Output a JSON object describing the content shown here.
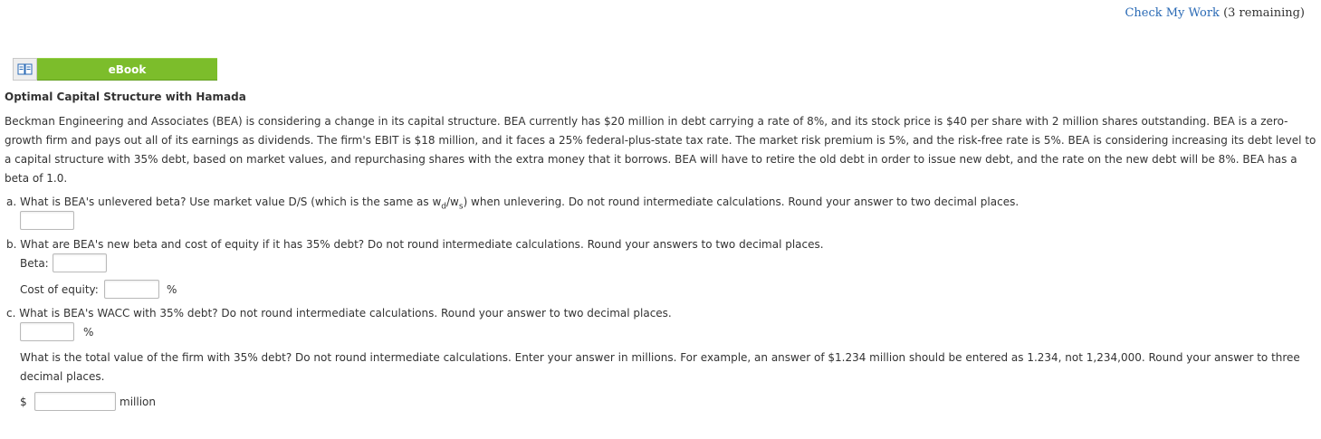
{
  "header": {
    "check_link": "Check My Work",
    "check_remaining": "(3 remaining)"
  },
  "ebook": {
    "icon": "book-icon",
    "label": "eBook"
  },
  "problem": {
    "title": "Optimal Capital Structure with Hamada",
    "intro": "Beckman Engineering and Associates (BEA) is considering a change in its capital structure. BEA currently has $20 million in debt carrying a rate of 8%, and its stock price is $40 per share with 2 million shares outstanding. BEA is a zero-growth firm and pays out all of its earnings as dividends. The firm's EBIT is $18 million, and it faces a 25% federal-plus-state tax rate. The market risk premium is 5%, and the risk-free rate is 5%. BEA is considering increasing its debt level to a capital structure with 35% debt, based on market values, and repurchasing shares with the extra money that it borrows. BEA will have to retire the old debt in order to issue new debt, and the rate on the new debt will be 8%. BEA has a beta of 1.0."
  },
  "questions": {
    "a": {
      "text_before": "a. What is BEA's unlevered beta? Use market value D/S (which is the same as w",
      "sub_d": "d",
      "slash": "/w",
      "sub_s": "s",
      "text_after": ") when unlevering. Do not round intermediate calculations. Round your answer to two decimal places.",
      "value": ""
    },
    "b": {
      "text": "b. What are BEA's new beta and cost of equity if it has 35% debt? Do not round intermediate calculations. Round your answers to two decimal places.",
      "beta_label": "Beta:",
      "beta_value": "",
      "coe_label": "Cost of equity:",
      "coe_value": "",
      "coe_unit": "%"
    },
    "c": {
      "text": "c. What is BEA's WACC with 35% debt? Do not round intermediate calculations. Round your answer to two decimal places.",
      "wacc_value": "",
      "wacc_unit": "%",
      "value_text": "What is the total value of the firm with 35% debt? Do not round intermediate calculations. Enter your answer in millions. For example, an answer of $1.234 million should be entered as 1.234, not 1,234,000. Round your answer to three decimal places.",
      "currency": "$",
      "firm_value": "",
      "unit": "million"
    }
  }
}
